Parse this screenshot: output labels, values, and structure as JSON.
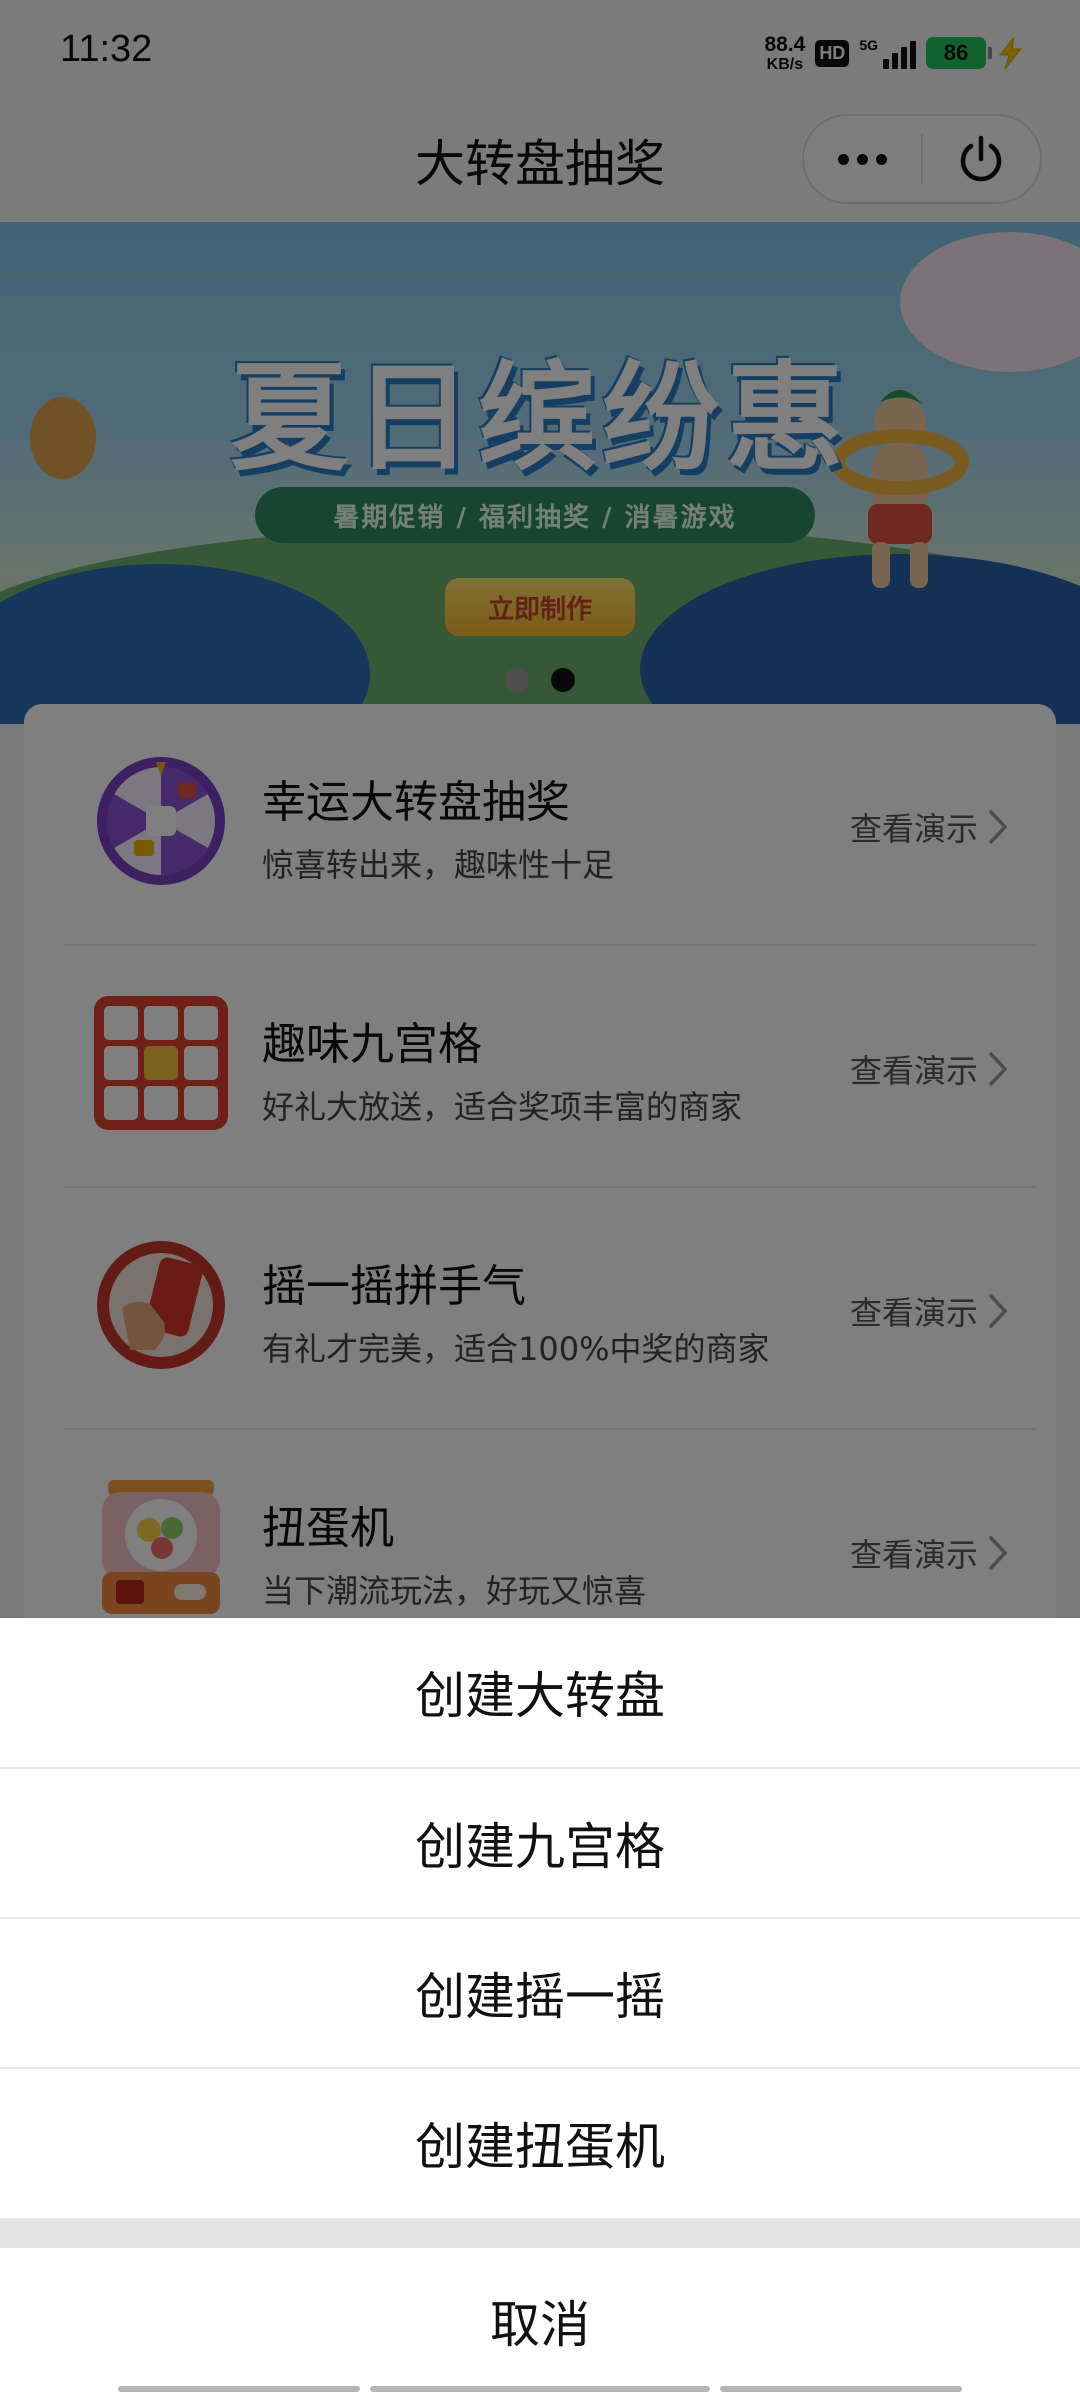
{
  "status_bar": {
    "time": "11:32",
    "net_speed_value": "88.4",
    "net_speed_unit": "KB/s",
    "hd_badge": "HD",
    "network_type": "5G",
    "battery": "86",
    "icons": [
      "hd-icon",
      "signal-icon",
      "battery-icon",
      "charging-bolt-icon"
    ]
  },
  "header": {
    "title": "大转盘抽奖",
    "capsule_icons": [
      "more-icon",
      "power-icon"
    ]
  },
  "banner": {
    "headline": "夏日缤纷惠",
    "ribbon": "暑期促销 / 福利抽奖 / 消暑游戏",
    "cta": "立即制作",
    "slide_count": 2,
    "active_slide": 2
  },
  "games": [
    {
      "name": "幸运大转盘抽奖",
      "desc": "惊喜转出来，趣味性十足",
      "demo": "查看演示",
      "icon": "lucky-wheel-icon"
    },
    {
      "name": "趣味九宫格",
      "desc": "好礼大放送，适合奖项丰富的商家",
      "demo": "查看演示",
      "icon": "nine-grid-icon"
    },
    {
      "name": "摇一摇拼手气",
      "desc": "有礼才完美，适合100%中奖的商家",
      "demo": "查看演示",
      "icon": "shake-phone-icon"
    },
    {
      "name": "扭蛋机",
      "desc": "当下潮流玩法，好玩又惊喜",
      "demo": "查看演示",
      "icon": "gashapon-icon"
    }
  ],
  "action_sheet": {
    "actions": [
      "创建大转盘",
      "创建九宫格",
      "创建摇一摇",
      "创建扭蛋机"
    ],
    "cancel": "取消"
  },
  "colors": {
    "overlay": "rgba(0,0,0,0.5)",
    "battery_green": "#22c55e",
    "charging_yellow": "#f5c400"
  }
}
